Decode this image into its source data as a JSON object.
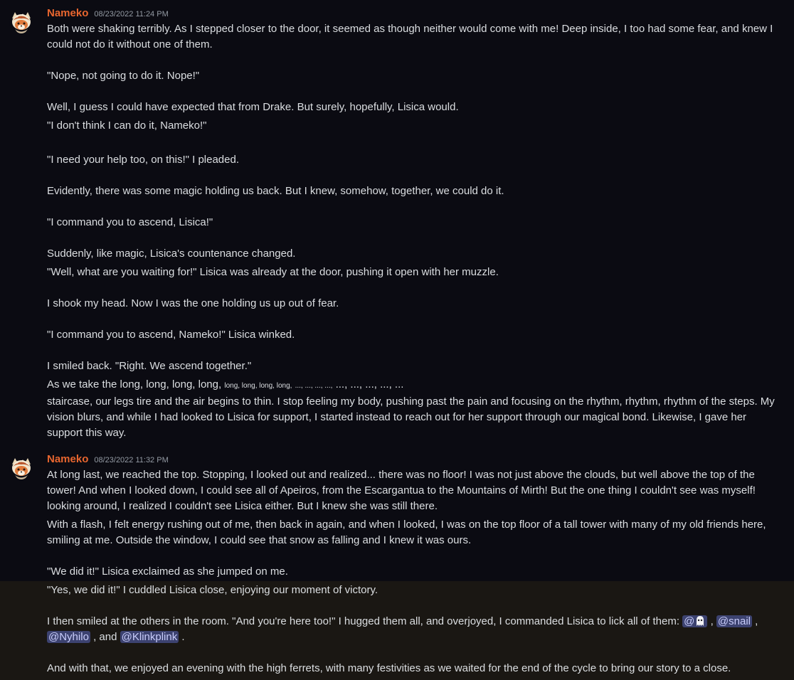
{
  "highlight_color": "#1a1713",
  "username_color": "#e8662f",
  "mention_bg": "#3c4270",
  "messages": [
    {
      "username": "Nameko",
      "timestamp": "08/23/2022 11:24 PM",
      "avatar_icon": "fox-mushroom-avatar",
      "l1": "Both were shaking terribly. As I stepped closer to the door, it seemed as though neither would come with me! Deep inside, I too had some fear, and knew I could not do it without one of them.",
      "l2": "\"Nope, not going to do it. Nope!\"",
      "l3": "Well, I guess I could have expected that from Drake. But surely, hopefully, Lisica would.",
      "l4": "\"I don't think I can do it, Nameko!\"",
      "l5": "\"I need your help too, on this!\" I pleaded.",
      "l6": "Evidently, there was some magic holding us back. But I knew, somehow, together, we could do it.",
      "l7": "\"I command you to ascend, Lisica!\"",
      "l8": "Suddenly, like magic, Lisica's countenance changed.",
      "l9": "\"Well, what are you waiting for!\" Lisica was already at the door, pushing it open with her muzzle.",
      "l10": "I shook my head. Now I was the one holding us up out of fear.",
      "l11": "\"I command you to ascend, Nameko!\" Lisica winked.",
      "l12": "I smiled back. \"Right. We ascend together.\"",
      "l13a": "As we take the long, long, long, long,",
      "l13b": "long, long, long, long,",
      "l13c": "..., ..., ..., ...,",
      "l13d": "..., ..., ..., ..., ...",
      "l14": "staircase, our legs tire and the air begins to thin. I stop feeling my body, pushing past the pain and focusing on the rhythm, rhythm, rhythm of the steps. My vision blurs, and while I had looked to Lisica for support, I started instead to reach out for her support through our magical bond. Likewise, I gave her support this way."
    },
    {
      "username": "Nameko",
      "timestamp": "08/23/2022 11:32 PM",
      "avatar_icon": "fox-mushroom-avatar",
      "l1": "At long last, we reached the top. Stopping, I looked out and realized... there was no floor! I was not just above the clouds, but well above the top of the tower! And when I looked down, I could see all of Apeiros, from the Escargantua to the Mountains of Mirth! But the one thing I couldn't see was myself! looking around, I realized I couldn't see Lisica either. But I knew she was still there.",
      "l2": "With a flash, I felt energy rushing out of me, then back in again, and when I looked, I was on the top floor of a tall tower with many of my old friends here, smiling at me. Outside the window, I could see that snow as falling and I knew it was ours.",
      "l3": "\"We did it!\" Lisica exclaimed as she jumped on me.",
      "l4": "\"Yes, we did it!\" I cuddled Lisica close, enjoying our moment of victory.",
      "l5_text": "I then smiled at the others in the room. \"And you're here too!\" I hugged them all, and overjoyed, I commanded Lisica to lick all of them:",
      "mention_ghost": "@",
      "sep1": ",",
      "mention_snail": "@snail",
      "sep2": ",",
      "mention_nyhilo": "@Nyhilo",
      "sep3": ", and",
      "mention_klinkplink": "@Klinkplink",
      "end": ".",
      "l6": "And with that, we enjoyed an evening with the high ferrets, with many festivities as we waited for the end of the cycle to bring our story to a close."
    }
  ]
}
